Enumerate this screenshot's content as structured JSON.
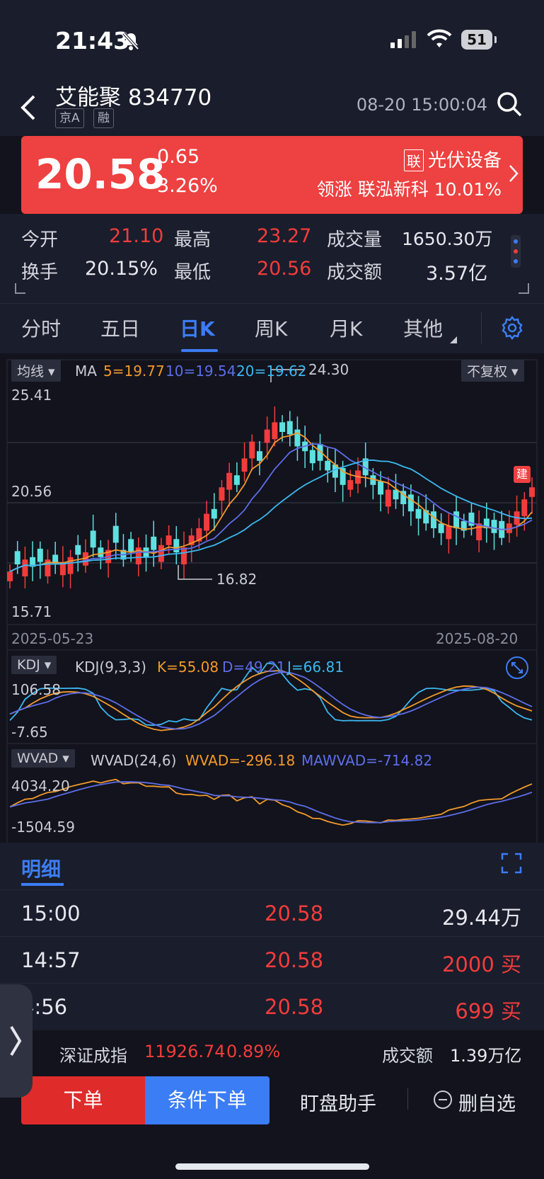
{
  "status_bar": {
    "time": "21:43",
    "battery": "51"
  },
  "header": {
    "title": "艾能聚 834770",
    "tags": [
      "京A",
      "融"
    ],
    "datetime": "08-20 15:00:04"
  },
  "quote": {
    "price": "20.58",
    "change": "0.65",
    "change_pct": "3.26%",
    "sector_badge": "联",
    "sector": "光伏设备",
    "leader": "领涨 联泓新科 10.01%"
  },
  "stats": [
    {
      "label": "今开",
      "value": "21.10",
      "color": "red"
    },
    {
      "label": "最高",
      "value": "23.27",
      "color": "red"
    },
    {
      "label": "成交量",
      "value": "1650.30万",
      "color": "white"
    },
    {
      "label": "换手",
      "value": "20.15%",
      "color": "white"
    },
    {
      "label": "最低",
      "value": "20.56",
      "color": "red"
    },
    {
      "label": "成交额",
      "value": "3.57亿",
      "color": "white"
    }
  ],
  "tabs": [
    "分时",
    "五日",
    "日K",
    "周K",
    "月K",
    "其他"
  ],
  "active_tab": "日K",
  "kline": {
    "ma_dropdown": "均线",
    "ma_label": "MA",
    "ma5": "5=19.77",
    "ma10": "10=19.54",
    "ma20": "20=19.62",
    "adjust_dropdown": "不复权",
    "y_top": "25.41",
    "y_mid": "20.56",
    "y_bot": "15.71",
    "high_mark": "24.30",
    "low_mark": "16.82",
    "date_start": "2025-05-23",
    "date_end": "2025-08-20",
    "build_badge": "建"
  },
  "kdj": {
    "dropdown": "KDJ",
    "params": "KDJ(9,3,3)",
    "k": "K=55.08",
    "d": "D=49.21",
    "j": "J=66.81",
    "y_top": "106.58",
    "y_bot": "-7.65"
  },
  "wvad": {
    "dropdown": "WVAD",
    "params": "WVAD(24,6)",
    "wvad": "WVAD=-296.18",
    "mawvad": "MAWVAD=-714.82",
    "y_top": "4034.20",
    "y_bot": "-1504.59"
  },
  "colors": {
    "up": "#f23c3c",
    "down": "#5ee0e0",
    "ma5": "#f39a2b",
    "ma10": "#5d6ee8",
    "ma20": "#3bb8f0",
    "accent": "#3b7df5"
  },
  "detail": {
    "title": "明细",
    "rows": [
      {
        "time": "15:00",
        "price": "20.58",
        "vol": "29.44万",
        "side": ""
      },
      {
        "time": "14:57",
        "price": "20.58",
        "vol": "2000 买",
        "side": "buy"
      },
      {
        "time": "4:56",
        "price": "20.58",
        "vol": "699 买",
        "side": "buy"
      }
    ]
  },
  "index_bar": {
    "name": "深证成指",
    "value": "11926.74",
    "pct": "0.89%",
    "amount_label": "成交额",
    "amount": "1.39万亿"
  },
  "actions": {
    "order": "下单",
    "conditional": "条件下单",
    "assistant": "盯盘助手",
    "remove": "删自选"
  }
}
